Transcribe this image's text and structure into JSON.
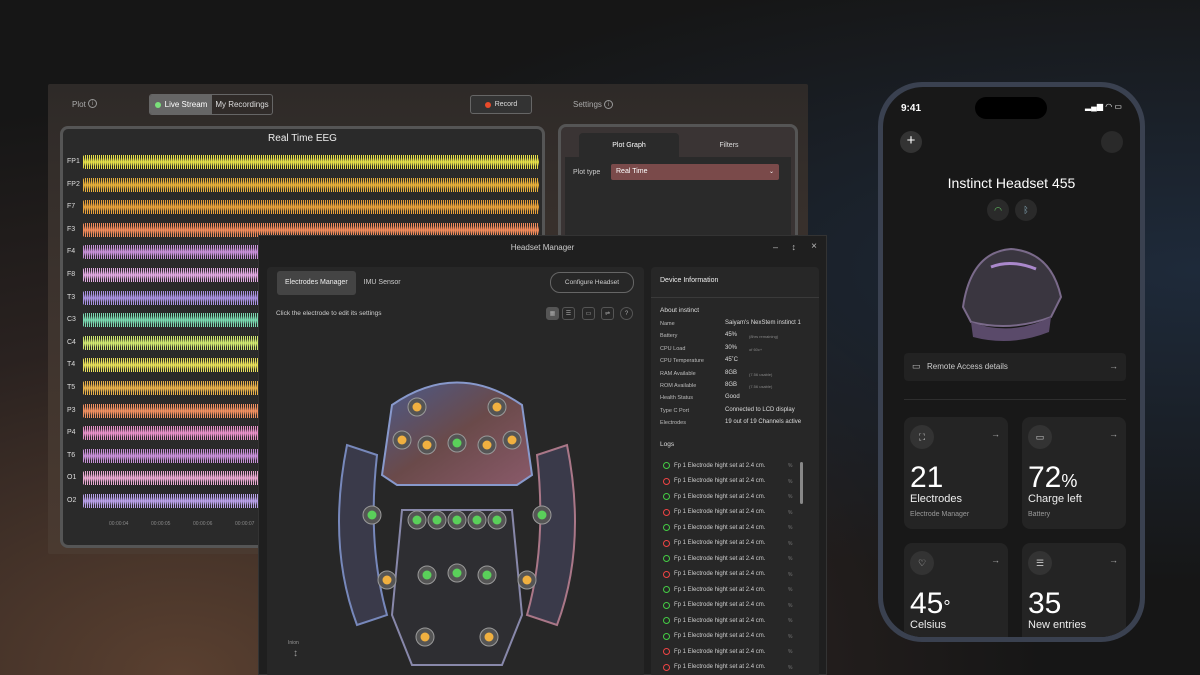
{
  "eeg_window": {
    "plot_label": "Plot",
    "live_stream": "Live Stream",
    "my_recordings": "My Recordings",
    "record": "Record",
    "settings": "Settings",
    "panel_title": "Real Time EEG",
    "channels": [
      "FP1",
      "FP2",
      "F7",
      "F3",
      "F4",
      "F8",
      "T3",
      "C3",
      "C4",
      "T4",
      "T5",
      "P3",
      "P4",
      "T6",
      "O1",
      "O2"
    ],
    "channel_colors": [
      "#e6e04a",
      "#e8b03a",
      "#e8a03a",
      "#f08a5a",
      "#c890d8",
      "#e0a8e0",
      "#a890e0",
      "#7ad8b0",
      "#d0e870",
      "#e8e05a",
      "#e8b04a",
      "#f09060",
      "#e890c8",
      "#c890d8",
      "#e8a8d0",
      "#b8a0e8"
    ],
    "times": [
      "00:00:04",
      "00:00:05",
      "00:00:06",
      "00:00:07"
    ],
    "plot_graph_tab": "Plot Graph",
    "filters_tab": "Filters",
    "plot_type_label": "Plot type",
    "plot_type_value": "Real Time"
  },
  "headset_manager": {
    "title": "Headset Manager",
    "tab_electrodes": "Electrodes Manager",
    "tab_imu": "IMU Sensor",
    "configure": "Configure Headset",
    "hint": "Click the electrode to edit its settings",
    "inion": "Inion",
    "device_info_title": "Device Information",
    "about": "About instinct",
    "info": [
      {
        "k": "Name",
        "v": "Saiyam's NexStem instinct 1"
      },
      {
        "k": "Battery",
        "v": "45%",
        "s": "(8hrs remaining)"
      },
      {
        "k": "CPU Load",
        "v": "30%",
        "s": "of 60c+"
      },
      {
        "k": "CPU Temperature",
        "v": "45˚C"
      },
      {
        "k": "RAM Available",
        "v": "8GB",
        "s": "(7.56 usable)"
      },
      {
        "k": "ROM Available",
        "v": "8GB",
        "s": "(7.56 usable)"
      },
      {
        "k": "Health Status",
        "v": "Good"
      },
      {
        "k": "Type C Port",
        "v": "Connected to LCD display"
      },
      {
        "k": "Electrodes",
        "v": "19 out of 19 Channels active"
      }
    ],
    "logs_title": "Logs",
    "logs": [
      {
        "t": "Fp 1 Electrode hight set at 2.4 cm.",
        "ok": true
      },
      {
        "t": "Fp 1 Electrode hight set at 2.4 cm.",
        "ok": false
      },
      {
        "t": "Fp 1 Electrode hight set at 2.4 cm.",
        "ok": true
      },
      {
        "t": "Fp 1 Electrode hight set at 2.4 cm.",
        "ok": false
      },
      {
        "t": "Fp 1 Electrode hight set at 2.4 cm.",
        "ok": true
      },
      {
        "t": "Fp 1 Electrode hight set at 2.4 cm.",
        "ok": false
      },
      {
        "t": "Fp 1 Electrode hight set at 2.4 cm.",
        "ok": true
      },
      {
        "t": "Fp 1 Electrode hight set at 2.4 cm.",
        "ok": false
      },
      {
        "t": "Fp 1 Electrode hight set at 2.4 cm.",
        "ok": true
      },
      {
        "t": "Fp 1 Electrode hight set at 2.4 cm.",
        "ok": true
      },
      {
        "t": "Fp 1 Electrode hight set at 2.4 cm.",
        "ok": true
      },
      {
        "t": "Fp 1 Electrode hight set at 2.4 cm.",
        "ok": true
      },
      {
        "t": "Fp 1 Electrode hight set at 2.4 cm.",
        "ok": false
      },
      {
        "t": "Fp 1 Electrode hight set at 2.4 cm.",
        "ok": false
      }
    ],
    "log_pct": "%"
  },
  "phone": {
    "time": "9:41",
    "title": "Instinct Headset  455",
    "remote": "Remote Access details",
    "cards": [
      {
        "big": "21",
        "unit": "",
        "label": "Electrodes",
        "sub": "Electrode Manager",
        "icon": "frame-icon"
      },
      {
        "big": "72",
        "unit": "%",
        "label": "Charge left",
        "sub": "Battery",
        "icon": "battery-icon"
      },
      {
        "big": "45",
        "unit": "°",
        "label": "Celsius",
        "sub": "",
        "icon": "heart-icon"
      },
      {
        "big": "35",
        "unit": "",
        "label": "New entries",
        "sub": "",
        "icon": "database-icon"
      }
    ]
  }
}
